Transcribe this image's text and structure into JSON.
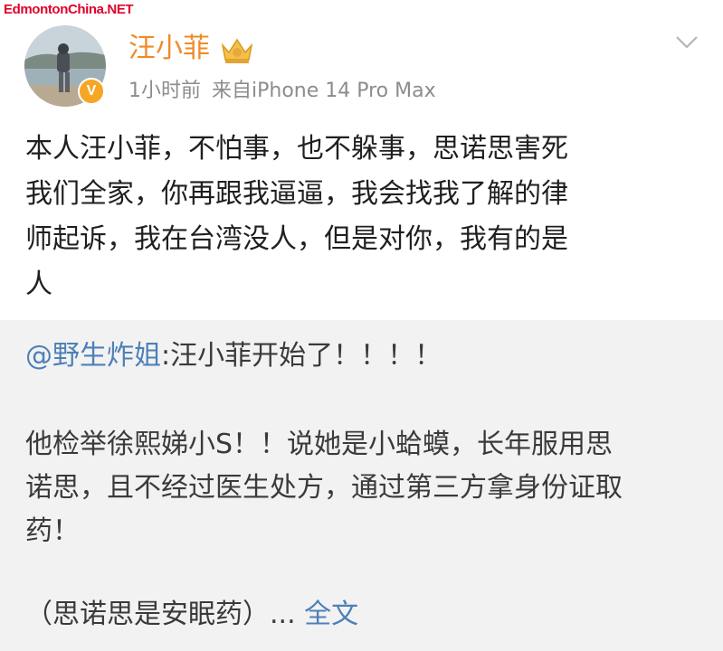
{
  "watermark": {
    "text": "EdmontonChina.NET"
  },
  "post": {
    "author": {
      "name": "汪小菲",
      "verified_badge": "V",
      "badge_icon": "crown-icon"
    },
    "meta": {
      "time": "1小时前",
      "source": "来自iPhone 14 Pro Max"
    },
    "text_lines": [
      "本人汪小菲，不怕事，也不躲事，思诺思害死",
      "我们全家，你再跟我逼逼，我会找我了解的律",
      "师起诉，我在台湾没人，但是对你，我有的是",
      "人"
    ]
  },
  "repost": {
    "mention": "@野生炸姐",
    "first_line": ":汪小菲开始了！！！！",
    "body_lines": [
      "他检举徐熙娣小S！！说她是小蛤蟆，长年服用思",
      "诺思，且不经过医生处方，通过第三方拿身份证取",
      "药！"
    ],
    "last_line": "（思诺思是安眠药）...",
    "full_text_link": "全文"
  },
  "colors": {
    "username": "#f08a27",
    "link": "#4d80b8",
    "meta": "#8c8c8c",
    "watermark": "#e0002a"
  }
}
